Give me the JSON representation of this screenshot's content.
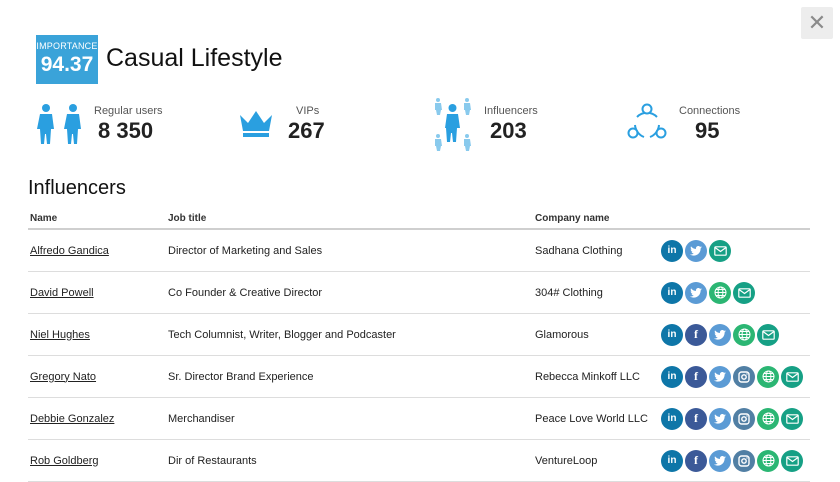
{
  "header": {
    "importance_label": "IMPORTANCE",
    "importance_value": "94.37",
    "title": "Casual Lifestyle"
  },
  "stats": [
    {
      "label": "Regular users",
      "value": "8 350",
      "icon": "users-icon"
    },
    {
      "label": "VIPs",
      "value": "267",
      "icon": "crown-icon"
    },
    {
      "label": "Influencers",
      "value": "203",
      "icon": "influencers-icon"
    },
    {
      "label": "Connections",
      "value": "95",
      "icon": "connections-icon"
    }
  ],
  "section_title": "Influencers",
  "table": {
    "columns": [
      "Name",
      "Job title",
      "Company name",
      ""
    ],
    "rows": [
      {
        "name": "Alfredo Gandica",
        "job": "Director of Marketing and Sales",
        "company": "Sadhana Clothing",
        "social": [
          "linkedin",
          "twitter",
          "email"
        ]
      },
      {
        "name": "David Powell",
        "job": "Co Founder & Creative Director",
        "company": "304# Clothing",
        "social": [
          "linkedin",
          "twitter",
          "web",
          "email"
        ]
      },
      {
        "name": "Niel Hughes",
        "job": "Tech Columnist, Writer, Blogger and Podcaster",
        "company": "Glamorous",
        "social": [
          "linkedin",
          "facebook",
          "twitter",
          "web",
          "email"
        ]
      },
      {
        "name": "Gregory Nato",
        "job": "Sr. Director Brand Experience",
        "company": "Rebecca Minkoff LLC",
        "social": [
          "linkedin",
          "facebook",
          "twitter",
          "instagram",
          "web",
          "email"
        ]
      },
      {
        "name": "Debbie Gonzalez",
        "job": "Merchandiser",
        "company": "Peace Love World LLC",
        "social": [
          "linkedin",
          "facebook",
          "twitter",
          "instagram",
          "web",
          "email"
        ]
      },
      {
        "name": "Rob Goldberg",
        "job": "Dir of Restaurants",
        "company": "VentureLoop",
        "social": [
          "linkedin",
          "facebook",
          "twitter",
          "instagram",
          "web",
          "email"
        ]
      }
    ]
  },
  "colors": {
    "badge": "#3aa3d9",
    "icon_blue": "#2a9fe0",
    "linkedin": "#0e76a8",
    "facebook": "#3b5998",
    "twitter": "#5b9bd5",
    "instagram": "#517fa4",
    "web": "#2bb673",
    "email": "#16a085"
  },
  "close_icon": "close-icon"
}
